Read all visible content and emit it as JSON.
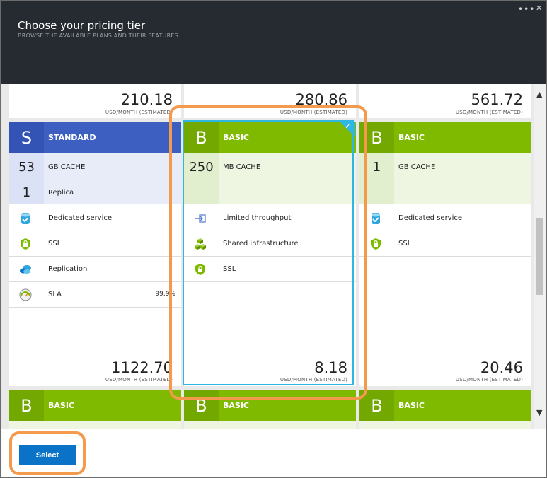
{
  "header": {
    "title": "Choose your pricing tier",
    "subtitle": "BROWSE THE AVAILABLE PLANS AND THEIR FEATURES",
    "more_glyph": "•••",
    "close_glyph": "✕"
  },
  "colors": {
    "standard": "#3d5fc1",
    "basic": "#7fba00",
    "selected": "#2fb6e2",
    "highlight": "#f39a4d",
    "button": "#0a73c7"
  },
  "top_prices": [
    {
      "price": "210.18",
      "unit": "USD/MONTH (ESTIMATED)"
    },
    {
      "price": "280.86",
      "unit": "USD/MONTH (ESTIMATED)"
    },
    {
      "price": "561.72",
      "unit": "USD/MONTH (ESTIMATED)"
    }
  ],
  "cards": [
    {
      "letter": "S",
      "name": "STANDARD",
      "specs": [
        {
          "num": "53",
          "label": "GB CACHE"
        },
        {
          "num": "1",
          "label": "Replica"
        }
      ],
      "features": [
        {
          "icon": "dedicated-service-icon",
          "label": "Dedicated service",
          "value": ""
        },
        {
          "icon": "ssl-shield-icon",
          "label": "SSL",
          "value": ""
        },
        {
          "icon": "replication-icon",
          "label": "Replication",
          "value": ""
        },
        {
          "icon": "sla-gauge-icon",
          "label": "SLA",
          "value": "99.9%"
        }
      ],
      "price": "1122.70",
      "unit": "USD/MONTH (ESTIMATED)"
    },
    {
      "letter": "B",
      "name": "BASIC",
      "specs": [
        {
          "num": "250",
          "label": "MB CACHE"
        }
      ],
      "features": [
        {
          "icon": "throughput-icon",
          "label": "Limited throughput",
          "value": ""
        },
        {
          "icon": "shared-infrastructure-icon",
          "label": "Shared infrastructure",
          "value": ""
        },
        {
          "icon": "ssl-shield-icon",
          "label": "SSL",
          "value": ""
        }
      ],
      "price": "8.18",
      "unit": "USD/MONTH (ESTIMATED)",
      "check_glyph": "✓"
    },
    {
      "letter": "B",
      "name": "BASIC",
      "specs": [
        {
          "num": "1",
          "label": "GB CACHE"
        }
      ],
      "features": [
        {
          "icon": "dedicated-service-icon",
          "label": "Dedicated service",
          "value": ""
        },
        {
          "icon": "ssl-shield-icon",
          "label": "SSL",
          "value": ""
        }
      ],
      "price": "20.46",
      "unit": "USD/MONTH (ESTIMATED)"
    }
  ],
  "bottom_tiers": [
    {
      "letter": "B",
      "name": "BASIC"
    },
    {
      "letter": "B",
      "name": "BASIC"
    },
    {
      "letter": "B",
      "name": "BASIC"
    }
  ],
  "scroll": {
    "up": "▲",
    "down": "▼"
  },
  "footer": {
    "select_label": "Select"
  }
}
